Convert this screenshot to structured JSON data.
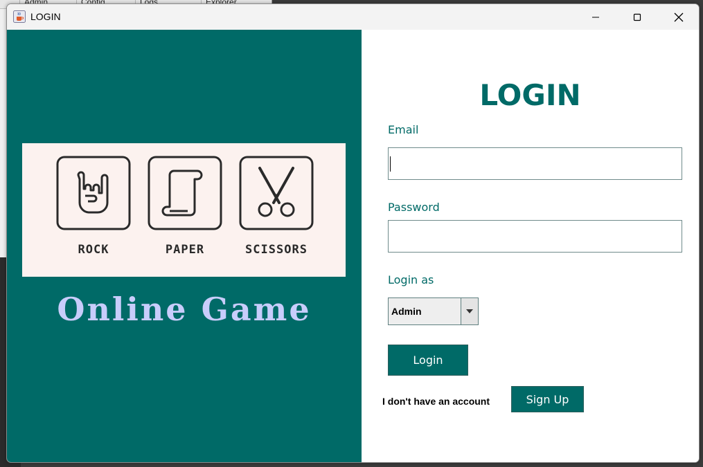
{
  "background_app": {
    "tabs": [
      "Admin",
      "Config",
      "Logs",
      "Explorer"
    ]
  },
  "window": {
    "title": "LOGIN",
    "app_icon": "java-cup-icon",
    "controls": [
      "minimize-icon",
      "maximize-icon",
      "close-icon"
    ]
  },
  "left_panel": {
    "background_color": "#006a67",
    "logo": {
      "items": [
        {
          "caption": "ROCK",
          "icon": "rock-hand-icon"
        },
        {
          "caption": "PAPER",
          "icon": "paper-scroll-icon"
        },
        {
          "caption": "SCISSORS",
          "icon": "scissors-icon"
        }
      ]
    },
    "tagline": "Online Game",
    "tagline_color": "#c8cdfb"
  },
  "form": {
    "heading": "LOGIN",
    "email_label": "Email",
    "email_value": "",
    "password_label": "Password",
    "password_value": "",
    "role_label": "Login as",
    "role_selected": "Admin",
    "login_button": "Login",
    "no_account_text": "I don't have an account",
    "signup_button": "Sign Up",
    "accent_color": "#006a67"
  }
}
